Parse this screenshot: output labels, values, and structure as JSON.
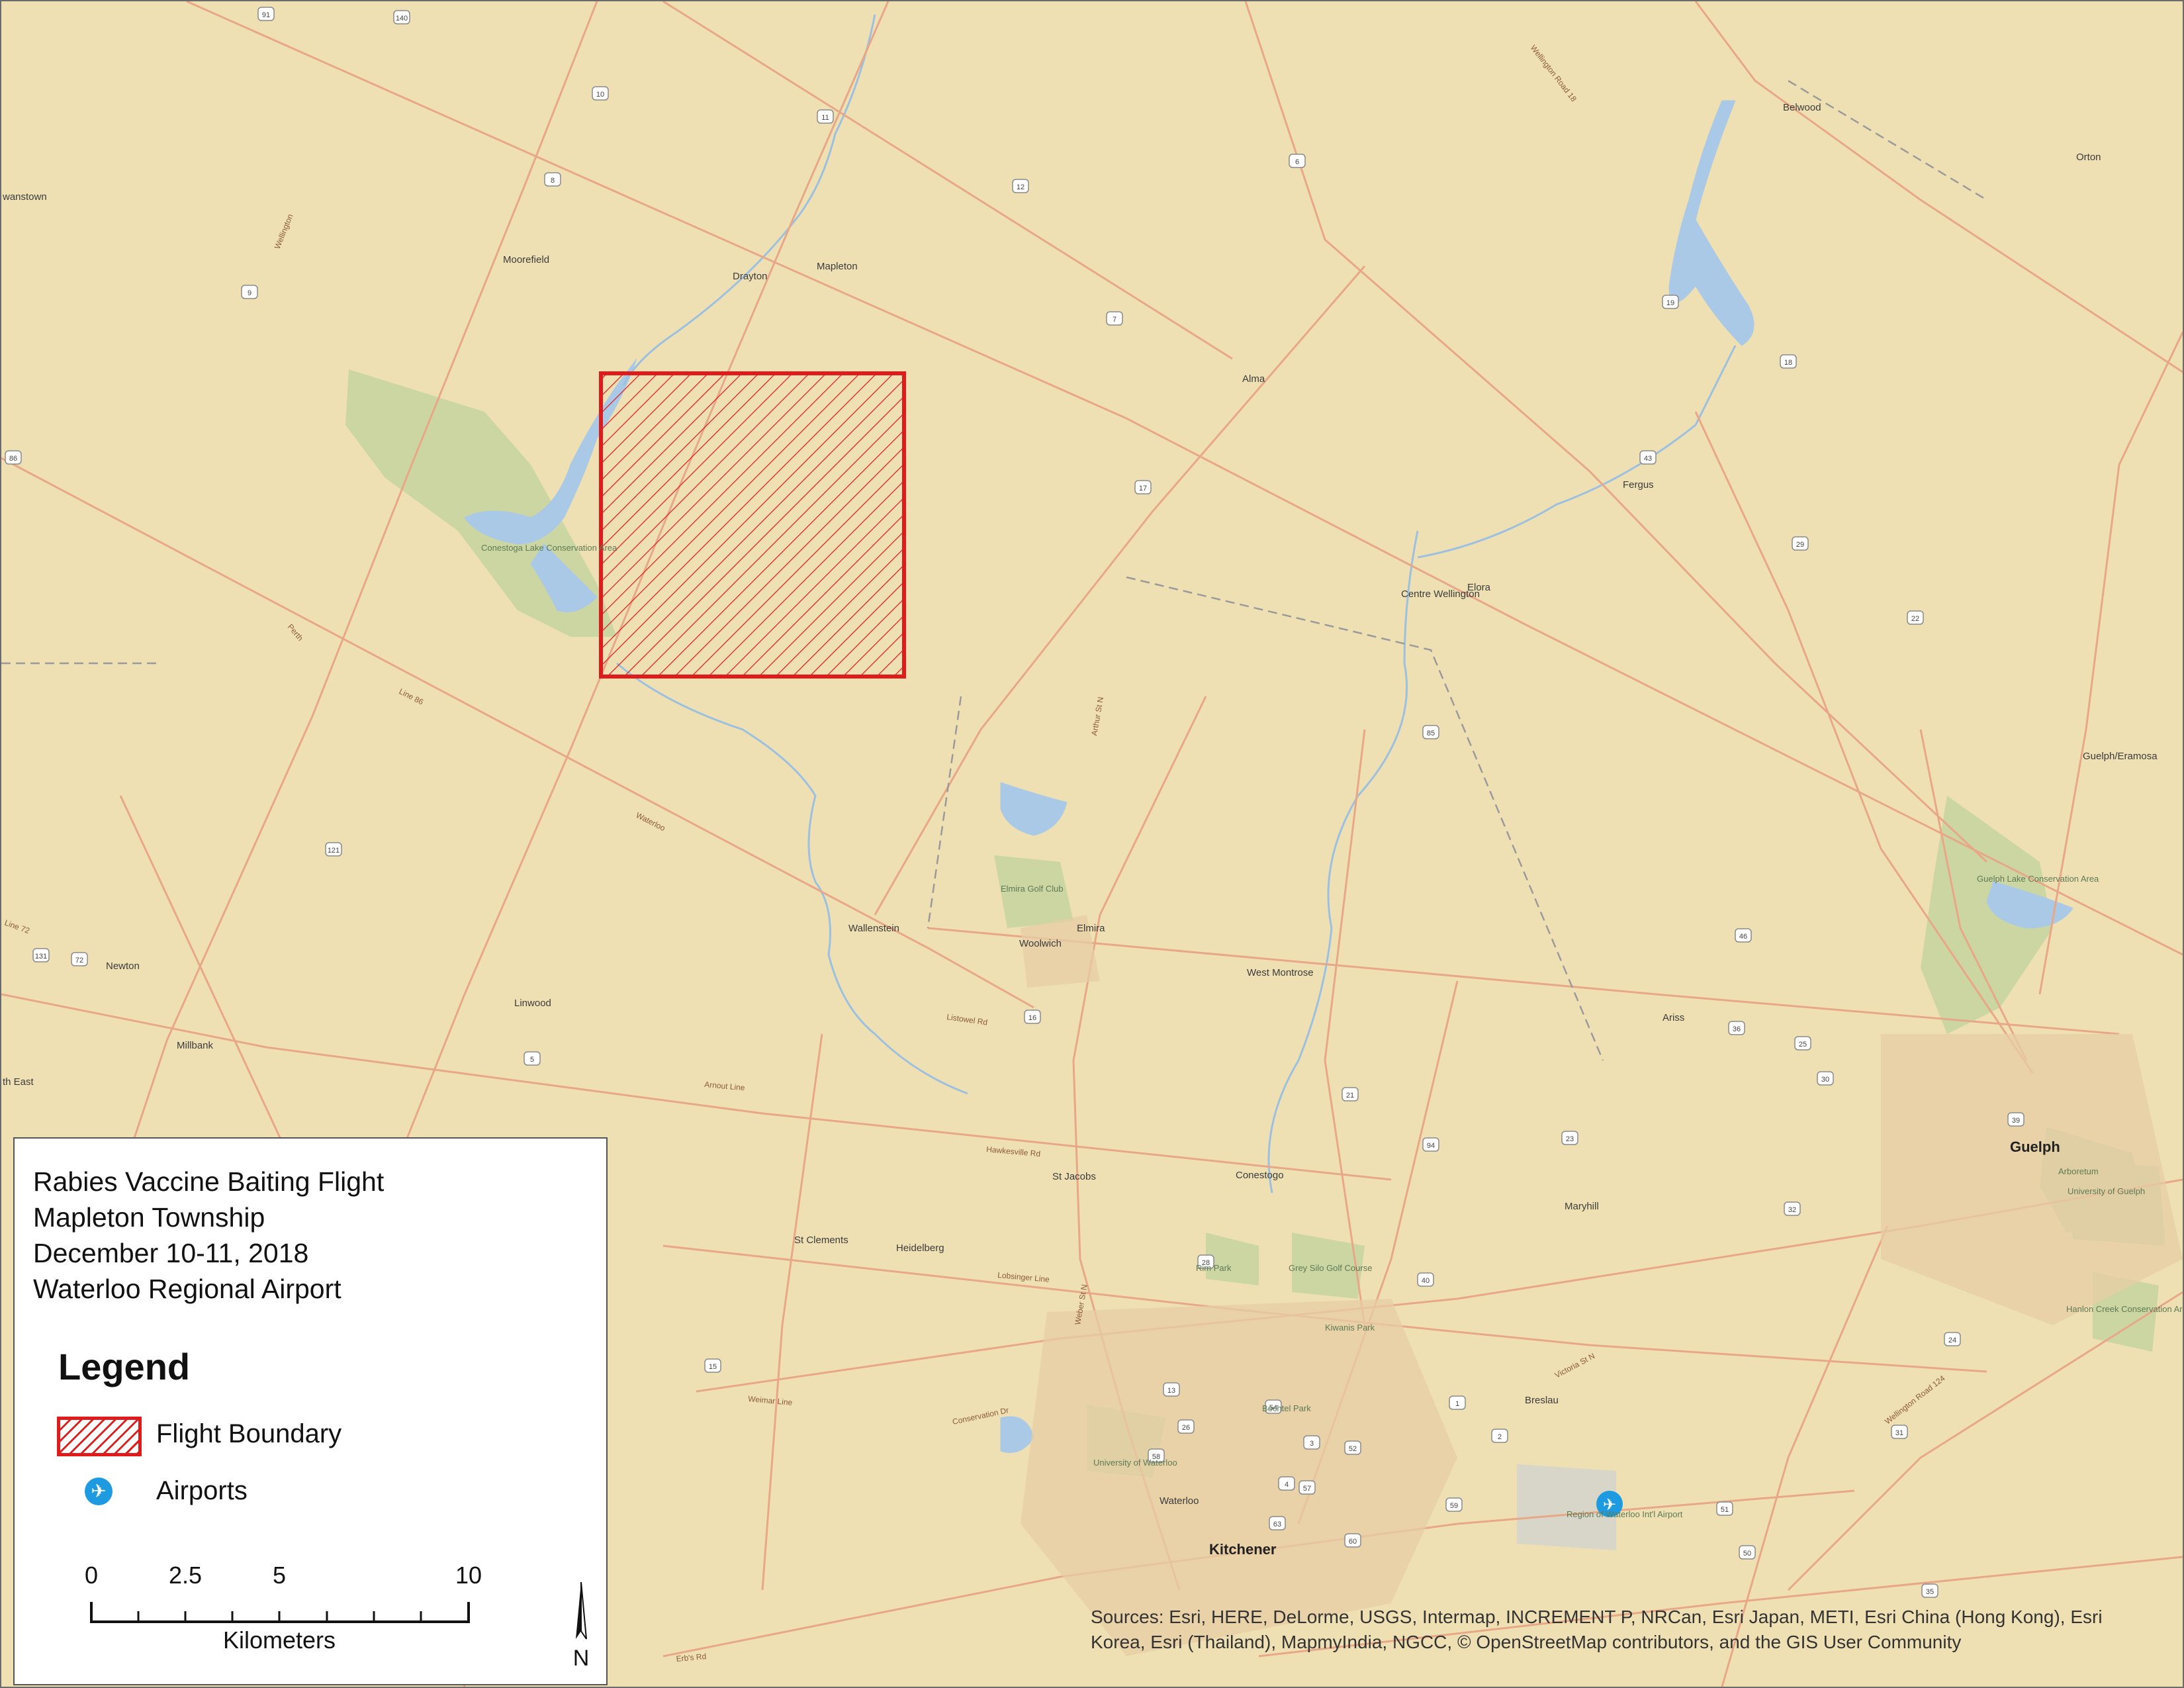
{
  "map": {
    "places": [
      "Drayton",
      "Mapleton",
      "Moorefield",
      "Alma",
      "Belwood",
      "Orton",
      "Fergus",
      "Elora",
      "Centre Wellington",
      "Wallenstein",
      "Elmira",
      "Woolwich",
      "West Montrose",
      "Newton",
      "Linwood",
      "Millbank",
      "Ariss",
      "St Jacobs",
      "Conestogo",
      "St Clements",
      "Heidelberg",
      "Maryhill",
      "Breslau",
      "Waterloo",
      "Kitchener",
      "Guelph",
      "Guelph/Eramosa",
      "wanstown",
      "th East"
    ],
    "parks": [
      "Conestoga Lake Conservation Area",
      "Elmira Golf Club",
      "Guelph Lake Conservation Area",
      "Rim Park",
      "Grey Silo Golf Course",
      "Kiwanis Park",
      "Bechtel Park",
      "University of Waterloo",
      "University of Guelph",
      "Arboretum",
      "Hanlon Creek Conservation Area",
      "Region of Waterloo Int'l Airport"
    ],
    "roads": [
      "Line 86",
      "Listowel Rd",
      "Arthur St N",
      "Weber St N",
      "Victoria St N",
      "Wellington Road 124",
      "Hawkesville Rd",
      "Lobsinger Line",
      "Arnout Line",
      "Weimar Line",
      "Conservation Dr",
      "Erb's Rd",
      "Wellington Road 18",
      "Line 72",
      "Perth",
      "Wellington",
      "Waterloo"
    ],
    "shields": [
      "91",
      "140",
      "10",
      "11",
      "8",
      "9",
      "12",
      "7",
      "6",
      "19",
      "18",
      "43",
      "29",
      "22",
      "17",
      "86",
      "121",
      "131",
      "72",
      "5",
      "15",
      "14",
      "16",
      "85",
      "21",
      "23",
      "25",
      "30",
      "39",
      "24",
      "46",
      "36",
      "51",
      "50",
      "35",
      "31",
      "32",
      "40",
      "94",
      "28",
      "13",
      "26",
      "57",
      "59",
      "58",
      "54",
      "1",
      "2",
      "3",
      "4",
      "52",
      "60",
      "63"
    ]
  },
  "info": {
    "title_lines": [
      "Rabies Vaccine Baiting Flight",
      "Mapleton Township",
      "December 10-11, 2018",
      "Waterloo Regional Airport"
    ],
    "legend_heading": "Legend",
    "legend_items": {
      "flight_boundary": "Flight Boundary",
      "airports": "Airports"
    },
    "scale": {
      "ticks": [
        "0",
        "2.5",
        "5",
        "10"
      ],
      "unit": "Kilometers"
    }
  },
  "north_arrow_label": "N",
  "attribution": "Sources: Esri, HERE, DeLorme, USGS, Intermap, INCREMENT P, NRCan, Esri Japan, METI, Esri China (Hong Kong), Esri Korea, Esri (Thailand), MapmyIndia, NGCC, © OpenStreetMap contributors, and the GIS User Community",
  "colors": {
    "background": "#efe0b4",
    "road": "#e8a787",
    "water": "#a9c9e6",
    "park": "#c6d3a0",
    "boundary": "#e01b1b",
    "airport": "#1e9be0"
  }
}
